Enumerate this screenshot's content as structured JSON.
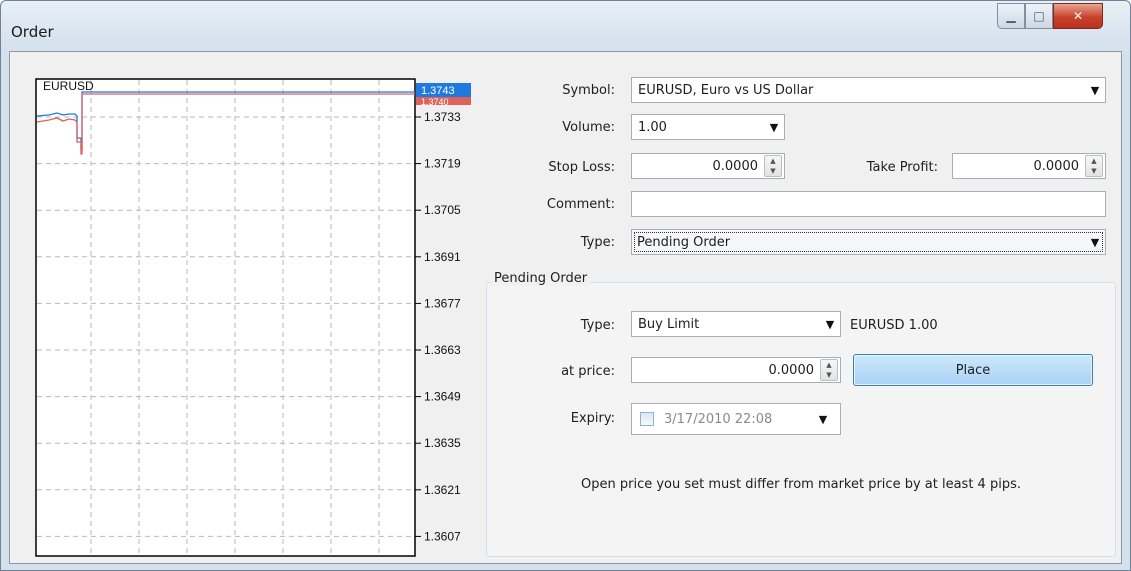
{
  "window": {
    "title": "Order"
  },
  "chart": {
    "symbol": "EURUSD",
    "price_labels": [
      "1.3733",
      "1.3719",
      "1.3705",
      "1.3691",
      "1.3677",
      "1.3663",
      "1.3649",
      "1.3635",
      "1.3621",
      "1.3607"
    ],
    "ask": "1.3743",
    "bid": "1.3740",
    "ask_color": "#1f7ae0",
    "bid_color": "#e0605a"
  },
  "form": {
    "symbol_label": "Symbol:",
    "symbol_value": "EURUSD, Euro vs US Dollar",
    "volume_label": "Volume:",
    "volume_value": "1.00",
    "stoploss_label": "Stop Loss:",
    "stoploss_value": "0.0000",
    "takeprofit_label": "Take Profit:",
    "takeprofit_value": "0.0000",
    "comment_label": "Comment:",
    "comment_value": "",
    "type_label": "Type:",
    "type_value": "Pending Order"
  },
  "pending": {
    "group_title": "Pending Order",
    "type_label": "Type:",
    "type_value": "Buy Limit",
    "type_summary": "EURUSD 1.00",
    "price_label": "at price:",
    "price_value": "0.0000",
    "place_label": "Place",
    "expiry_label": "Expiry:",
    "expiry_value": "3/17/2010 22:08",
    "note": "Open price you set must differ from market price by at least 4 pips."
  }
}
